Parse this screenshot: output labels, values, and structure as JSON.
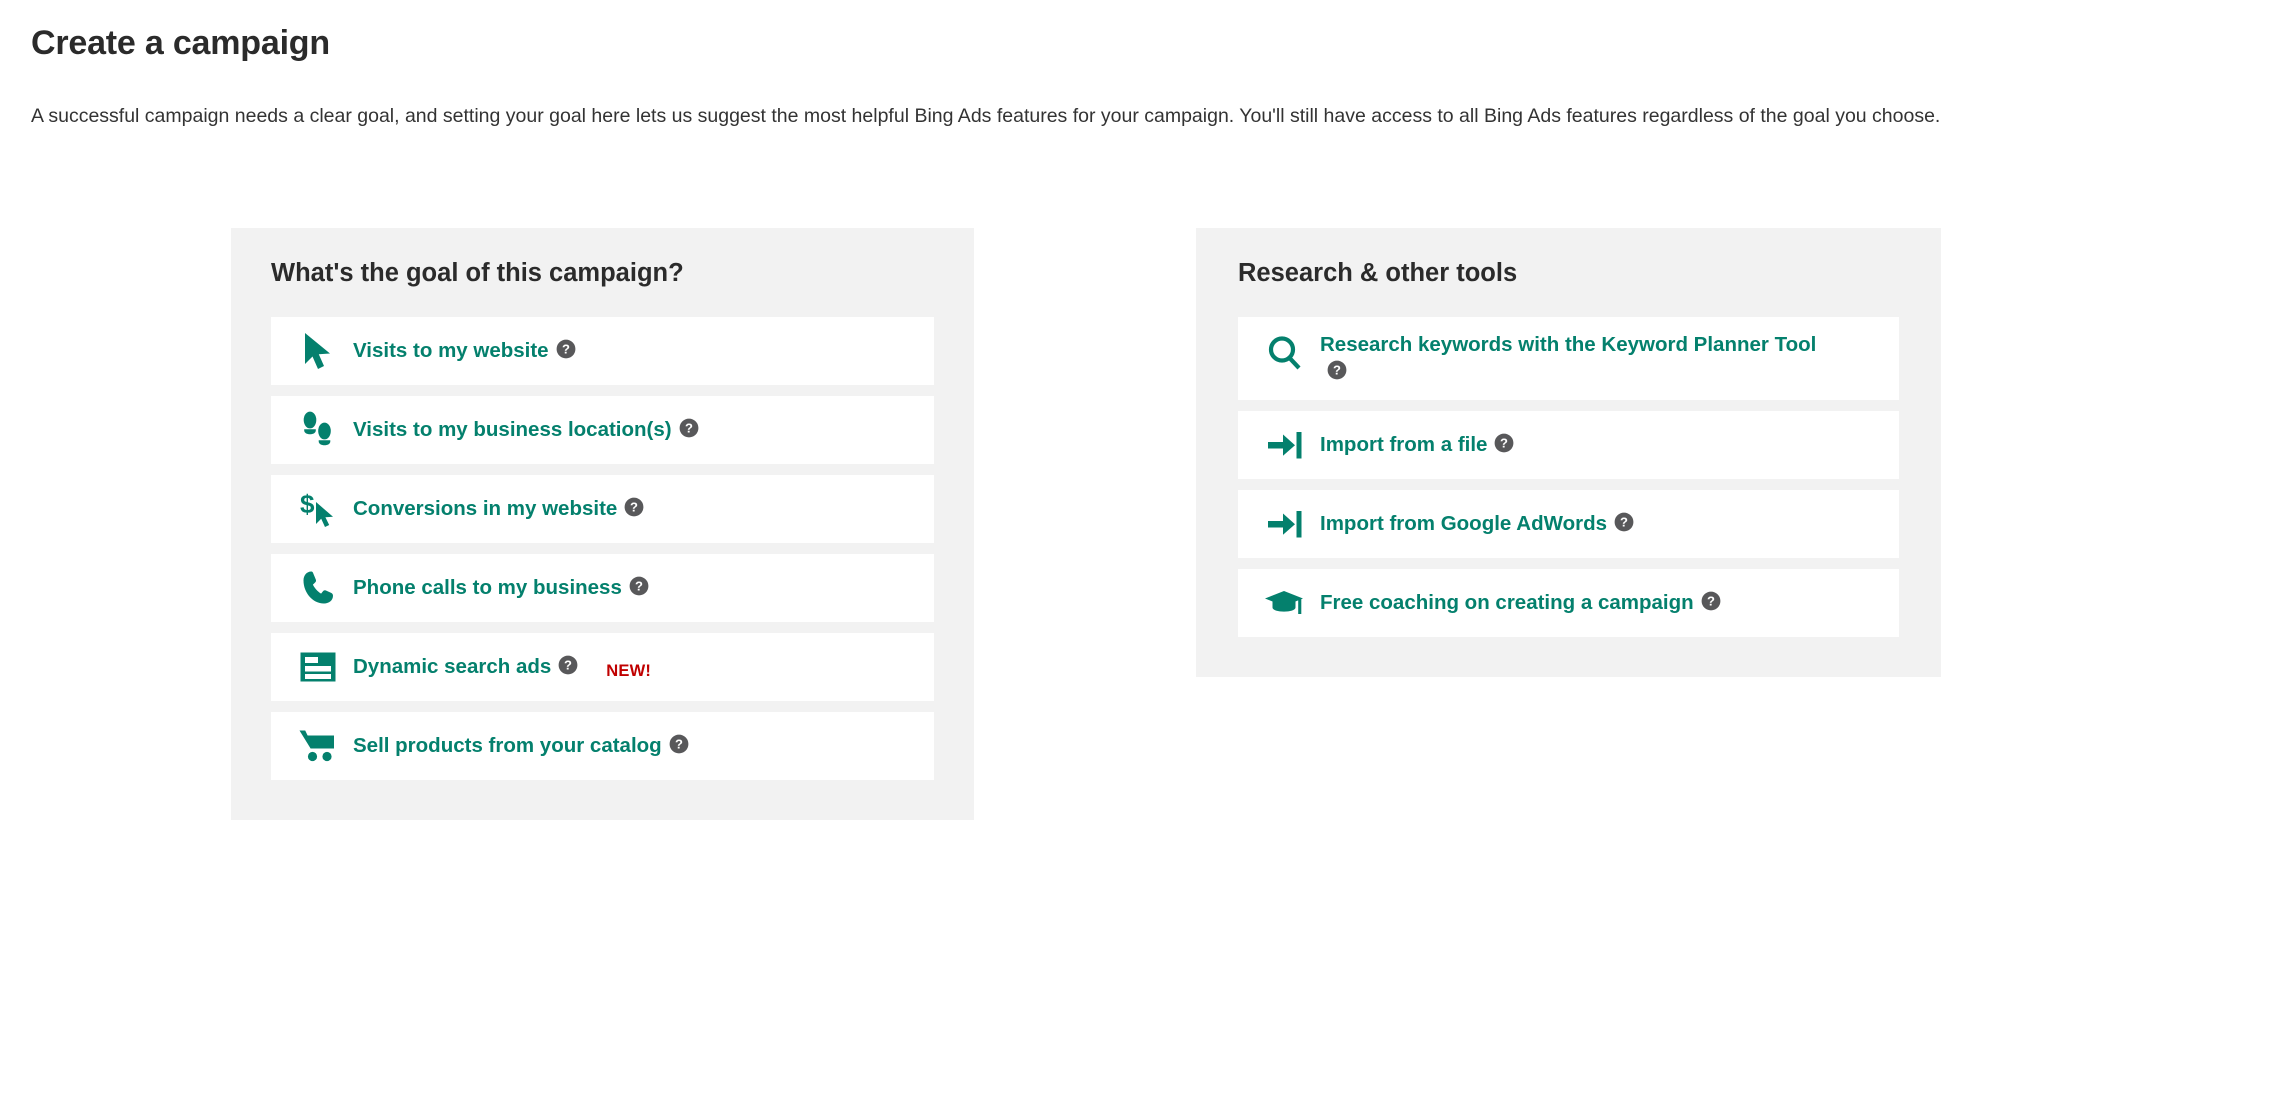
{
  "page": {
    "title": "Create a campaign",
    "description": "A successful campaign needs a clear goal, and setting your goal here lets us suggest the most helpful Bing Ads features for your campaign. You'll still have access to all Bing Ads features regardless of the goal you choose."
  },
  "colors": {
    "accent_green": "#04806d",
    "panel_background": "#f2f2f2",
    "card_background": "#ffffff",
    "heading_text": "#2b2b2b",
    "badge_red": "#c00000",
    "help_icon_gray": "#58585a"
  },
  "goals_panel": {
    "title": "What's the goal of this campaign?",
    "items": [
      {
        "label": "Visits to my website",
        "icon": "cursor-arrow-icon",
        "help": "help-icon",
        "badge": ""
      },
      {
        "label": "Visits to my business location(s)",
        "icon": "footprints-icon",
        "help": "help-icon",
        "badge": ""
      },
      {
        "label": "Conversions in my website",
        "icon": "dollar-cursor-icon",
        "help": "help-icon",
        "badge": ""
      },
      {
        "label": "Phone calls to my business",
        "icon": "phone-icon",
        "help": "help-icon",
        "badge": ""
      },
      {
        "label": "Dynamic search ads",
        "icon": "browser-window-icon",
        "help": "help-icon",
        "badge": "NEW!"
      },
      {
        "label": "Sell products from your catalog",
        "icon": "shopping-cart-icon",
        "help": "help-icon",
        "badge": ""
      }
    ]
  },
  "tools_panel": {
    "title": "Research & other tools",
    "items": [
      {
        "label": "Research keywords with the Keyword Planner Tool",
        "icon": "magnifier-icon",
        "help": "help-icon",
        "badge": ""
      },
      {
        "label": "Import from a file",
        "icon": "import-arrow-icon",
        "help": "help-icon",
        "badge": ""
      },
      {
        "label": "Import from Google AdWords",
        "icon": "import-arrow-icon",
        "help": "help-icon",
        "badge": ""
      },
      {
        "label": "Free coaching on creating a campaign",
        "icon": "graduation-cap-icon",
        "help": "help-icon",
        "badge": ""
      }
    ]
  }
}
